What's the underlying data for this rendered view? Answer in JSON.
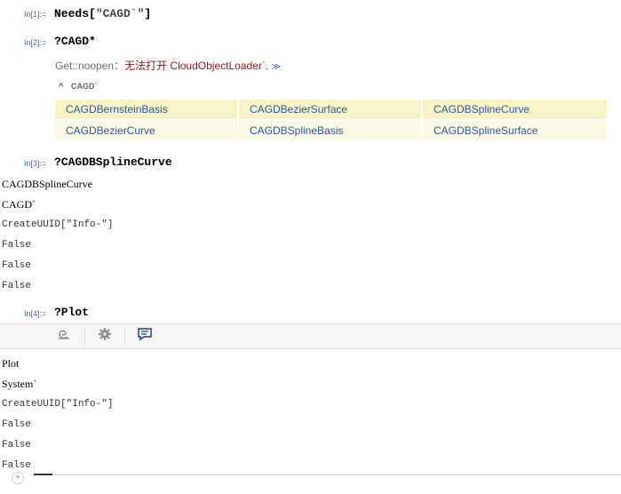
{
  "cells": [
    {
      "label": "In[1]:=",
      "input_prefix": "Needs[",
      "input_string": "\"CAGD`\"",
      "input_suffix": "]"
    },
    {
      "label": "In[2]:=",
      "input": "?CAGD*"
    },
    {
      "label": "In[3]:=",
      "input": "?CAGDBSplineCurve"
    },
    {
      "label": "In[4]:=",
      "input": "?Plot"
    }
  ],
  "message": {
    "prefix": "Get::noopen",
    "sep": "：",
    "text": "无法打开 CloudObjectLoader`.",
    "link": "≫"
  },
  "package_group": {
    "caret": "^",
    "name": "CAGD`"
  },
  "symbols": [
    [
      "CAGDBernsteinBasis",
      "CAGDBezierSurface",
      "CAGDBSplineCurve"
    ],
    [
      "CAGDBezierCurve",
      "CAGDBSplineBasis",
      "CAGDBSplineSurface"
    ]
  ],
  "output3": {
    "name": "CAGDBSplineCurve",
    "context": "CAGD`",
    "uuid": "CreateUUID[\"Info-\"]",
    "flags": [
      "False",
      "False",
      "False"
    ]
  },
  "toolbar": {
    "icons": [
      "wolfram-cloud-icon",
      "gear-icon",
      "speech-bubble-icon"
    ]
  },
  "output4": {
    "name": "Plot",
    "context": "System`",
    "uuid": "CreateUUID[\"Info-\"]",
    "flags": [
      "False",
      "False",
      "False"
    ]
  },
  "insert_button": "+"
}
